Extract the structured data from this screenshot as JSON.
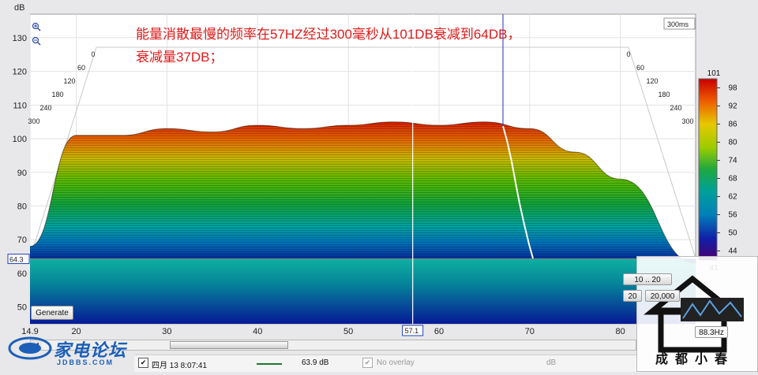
{
  "chart_data": {
    "type": "area",
    "title": "能量消散最慢的频率在57HZ经过300毫秒从101DB衰减到64DB，",
    "subtitle": "衰减量37DB；",
    "ylabel": "dB",
    "y_ticks": [
      "130",
      "120",
      "110",
      "100",
      "90",
      "80",
      "70",
      "60",
      "50"
    ],
    "ylim": [
      45,
      137
    ],
    "x_ticks": [
      "14.9",
      "20",
      "30",
      "40",
      "50",
      "60",
      "70",
      "80"
    ],
    "xlim": [
      14.9,
      88.3
    ],
    "time_ticks": [
      "0",
      "60",
      "120",
      "180",
      "240",
      "300"
    ],
    "time_label": "300ms",
    "cursor_x_label": "57.1",
    "cursor_y_label": "64.3",
    "cursor_x": 57.1,
    "cursor_y": 64.3,
    "colorbar_labels": [
      "101",
      "98",
      "92",
      "86",
      "80",
      "74",
      "68",
      "62",
      "56",
      "50",
      "44",
      "41"
    ],
    "colorbar_range": [
      41,
      101
    ],
    "series": [
      {
        "x": [
          14.9,
          20,
          25,
          30,
          35,
          40,
          45,
          50,
          55,
          60,
          65,
          70,
          75,
          80,
          88.3
        ],
        "values": [
          68,
          101,
          101,
          103,
          102,
          104,
          103,
          104,
          105,
          104,
          105,
          103,
          96,
          88,
          63
        ]
      },
      {
        "x": [
          14.9,
          20,
          25,
          30,
          35,
          40,
          45,
          50,
          55,
          60,
          65,
          70,
          75,
          80,
          88.3
        ],
        "values": [
          58,
          59,
          58,
          56,
          57,
          56,
          59,
          60,
          60,
          58,
          61,
          57,
          59,
          62,
          55
        ]
      }
    ]
  },
  "toolbar": {
    "generate_label": "Generate",
    "range1_label": "10 .. 20",
    "range2a_label": "20",
    "range2b_label": "20,000",
    "freq_readout": "88.3Hz",
    "zoom_in_icon": "zoom-in-icon",
    "zoom_out_icon": "zoom-out-icon"
  },
  "status": {
    "time": "四月 13 8:07:41",
    "value": "63.9 dB",
    "overlay": "No overlay",
    "overlay_unit": "dB",
    "check1": "✔",
    "check2": "✔"
  },
  "logo": {
    "name": "家电论坛",
    "sub": "JDBBS.COM"
  },
  "watermark": {
    "text": "成都小春"
  }
}
